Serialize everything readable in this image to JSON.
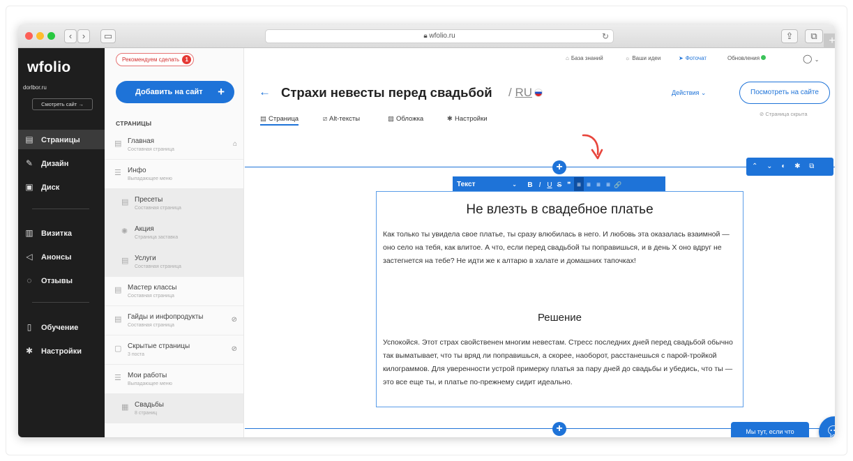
{
  "browser": {
    "url": "wfolio.ru",
    "back_icon": "chevron-left",
    "forward_icon": "chevron-right",
    "sidebar_icon": "sidebar-toggle",
    "share_icon": "share",
    "tabs_icon": "tabs",
    "plus": "+"
  },
  "sidebar": {
    "logo": "wfolio",
    "account": "dorlbor.ru",
    "visit_button": "Смотреть сайт →",
    "items": [
      {
        "icon": "page-icon",
        "label": "Страницы"
      },
      {
        "icon": "brush-icon",
        "label": "Дизайн"
      },
      {
        "icon": "disk-icon",
        "label": "Диск"
      },
      {
        "icon": "card-icon",
        "label": "Визитка"
      },
      {
        "icon": "megaphone-icon",
        "label": "Анонсы"
      },
      {
        "icon": "reviews-icon",
        "label": "Отзывы"
      },
      {
        "icon": "book-icon",
        "label": "Обучение"
      },
      {
        "icon": "gear-icon",
        "label": "Настройки"
      }
    ]
  },
  "pages_panel": {
    "recommend_label": "Рекомендуем сделать",
    "recommend_count": "1",
    "add_button": "Добавить на сайт",
    "add_plus": "+",
    "heading": "СТРАНИЦЫ",
    "items": [
      {
        "title": "Главная",
        "subtitle": "Составная страница",
        "right_icon": "⌂"
      },
      {
        "title": "Инфо",
        "subtitle": "Выпадающее меню",
        "right_icon": ""
      },
      {
        "title": "Пресеты",
        "subtitle": "Составная страница",
        "right_icon": ""
      },
      {
        "title": "Акция",
        "subtitle": "Страница заставка",
        "right_icon": ""
      },
      {
        "title": "Услуги",
        "subtitle": "Составная страница",
        "right_icon": ""
      },
      {
        "title": "Мастер классы",
        "subtitle": "Составная страница",
        "right_icon": ""
      },
      {
        "title": "Гайды и инфопродукты",
        "subtitle": "Составная страница",
        "right_icon": "⊘"
      },
      {
        "title": "Скрытые страницы",
        "subtitle": "3 поста",
        "right_icon": "⊘"
      },
      {
        "title": "Мои работы",
        "subtitle": "Выпадающее меню",
        "right_icon": ""
      },
      {
        "title": "Свадьбы",
        "subtitle": "8 страниц",
        "right_icon": ""
      }
    ]
  },
  "topnav": {
    "knowledge": "База знаний",
    "ideas": "Ваши идеи",
    "photochat": "Фоточат",
    "updates": "Обновления",
    "profile_caret": "⌄"
  },
  "editor": {
    "back_arrow": "←",
    "title": "Страхи невесты перед свадьбой",
    "lang_sep": "/",
    "lang": "RU",
    "actions": "Действия ⌄",
    "view_button": "Посмотреть на сайте",
    "hidden_note": "Страница скрыта",
    "tabs": [
      "Страница",
      "Alt-тексты",
      "Обложка",
      "Настройки"
    ],
    "right_tools": "⌃ ⌄ ◐ ✱ ⧉ 🗑",
    "format": {
      "style": "Текст",
      "buttons": [
        "B",
        "I",
        "U",
        "S",
        "❞",
        "≡",
        "≡",
        "≡",
        "≡",
        "🔗"
      ]
    },
    "content": {
      "heading": "Не влезть в свадебное платье",
      "p1": "Как только ты увидела свое платье, ты сразу влюбилась в него. И любовь эта оказалась взаимной — оно село на тебя, как влитое. А что, если перед свадьбой ты поправишься, и в день Х оно вдруг не застегнется на тебе? Не идти же к алтарю в халате и домашних тапочках!",
      "subheading": "Решение",
      "p2": "Успокойся. Этот страх свойственен многим невестам. Стресс последних дней перед свадьбой обычно так выматывает, что ты вряд ли поправишься, а скорее, наоборот, расстанешься с парой-тройкой килограммов. Для уверенности устрой примерку платья за пару дней до свадьбы и убедись, что ты — это все еще ты, и платье по-прежнему сидит идеально."
    },
    "chat_label": "Мы тут, если что",
    "chat_icon": "chat-icon"
  },
  "colors": {
    "accent": "#1e73d8",
    "sidebar_bg": "#1e1e1e",
    "badge_red": "#e53935",
    "arrow_red": "#e8453c",
    "online_green": "#3cc35a"
  }
}
